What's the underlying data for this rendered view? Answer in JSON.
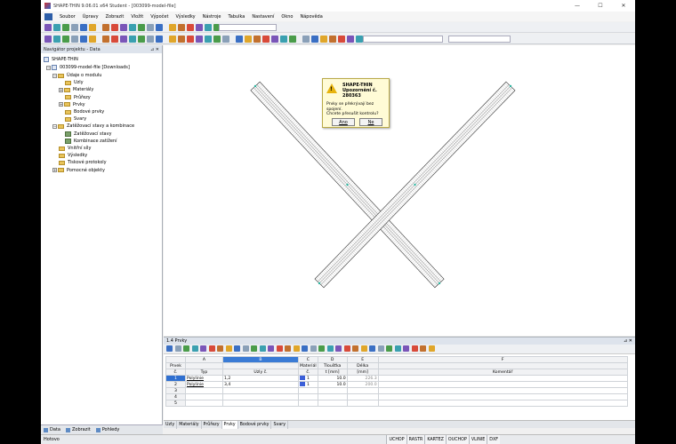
{
  "window": {
    "title": "SHAPE-THIN 9.06.01 x64 Student - [003099-model-file]",
    "minimize": "—",
    "maximize": "☐",
    "close": "✕"
  },
  "menu": [
    "Soubor",
    "Úpravy",
    "Zobrazit",
    "Vložit",
    "Výpočet",
    "Výsledky",
    "Nástroje",
    "Tabulka",
    "Nastavení",
    "Okno",
    "Nápověda"
  ],
  "navigator": {
    "title": "Navigátor projektu - Data",
    "controls": "⊿ ✕",
    "root": "SHAPE-THIN",
    "model": "003099-model-file [Downloads]",
    "items": [
      {
        "label": "Údaje o modulu",
        "level": 2,
        "exp": "−",
        "icon": "folder"
      },
      {
        "label": "Uzly",
        "level": 3,
        "exp": "",
        "icon": "folder"
      },
      {
        "label": "Materiály",
        "level": 3,
        "exp": "+",
        "icon": "folder"
      },
      {
        "label": "Průřezy",
        "level": 3,
        "exp": "",
        "icon": "folder"
      },
      {
        "label": "Prvky",
        "level": 3,
        "exp": "+",
        "icon": "folder"
      },
      {
        "label": "Bodové prvky",
        "level": 3,
        "exp": "",
        "icon": "folder"
      },
      {
        "label": "Svary",
        "level": 3,
        "exp": "",
        "icon": "folder"
      },
      {
        "label": "Zatěžovací stavy a kombinace",
        "level": 2,
        "exp": "−",
        "icon": "folder"
      },
      {
        "label": "Zatěžovací stavy",
        "level": 3,
        "exp": "",
        "icon": "sub"
      },
      {
        "label": "Kombinace zatížení",
        "level": 3,
        "exp": "",
        "icon": "sub"
      },
      {
        "label": "Vnitřní síly",
        "level": 2,
        "exp": "",
        "icon": "folder"
      },
      {
        "label": "Výsledky",
        "level": 2,
        "exp": "",
        "icon": "folder"
      },
      {
        "label": "Tiskové protokoly",
        "level": 2,
        "exp": "",
        "icon": "folder"
      },
      {
        "label": "Pomocné objekty",
        "level": 2,
        "exp": "+",
        "icon": "folder"
      }
    ],
    "tabs": [
      "Data",
      "Zobrazit",
      "Pohledy"
    ]
  },
  "dialog": {
    "app": "SHAPE-THIN",
    "subtitle": "Upozornění č.",
    "code": "280363",
    "message_1": "Prvky se překrývají bez spojení.",
    "message_2": "Chcete přesušit kontrolu?",
    "yes": "Ano",
    "no": "Ne"
  },
  "table": {
    "title": "1.4 Prvky",
    "controls": "⊿ ✕",
    "col_letters": [
      "A",
      "B",
      "C",
      "D",
      "E",
      "F"
    ],
    "col_head_1": [
      "Prvek",
      "",
      "",
      "Materiál",
      "Tloušťka",
      "Délka",
      ""
    ],
    "col_head_2": [
      "č.",
      "Typ",
      "Uzly č.",
      "č.",
      "t [mm]",
      "[mm]",
      "Komentář"
    ],
    "rows": [
      {
        "no": "1",
        "type": "Polylinie",
        "nodes": "1,2",
        "mat": "1",
        "t": "10.0",
        "len": "226.3"
      },
      {
        "no": "2",
        "type": "Polylinie",
        "nodes": "3,4",
        "mat": "1",
        "t": "10.0",
        "len": "200.0"
      },
      {
        "no": "3",
        "type": "",
        "nodes": "",
        "mat": "",
        "t": "",
        "len": ""
      },
      {
        "no": "4",
        "type": "",
        "nodes": "",
        "mat": "",
        "t": "",
        "len": ""
      },
      {
        "no": "5",
        "type": "",
        "nodes": "",
        "mat": "",
        "t": "",
        "len": ""
      }
    ],
    "tabs": [
      "Uzly",
      "Materiály",
      "Průřezy",
      "Prvky",
      "Bodové prvky",
      "Svary"
    ],
    "active_tab": 3
  },
  "status": {
    "text": "Hotovo",
    "cells": [
      "UCHOP",
      "RASTR",
      "KARTEZ",
      "OUCHOP",
      "VLINIE",
      "DXF"
    ]
  },
  "colors": {
    "accent": "#2f6fd0",
    "material": "#3b5fd8",
    "warning": "#e7b30d"
  }
}
